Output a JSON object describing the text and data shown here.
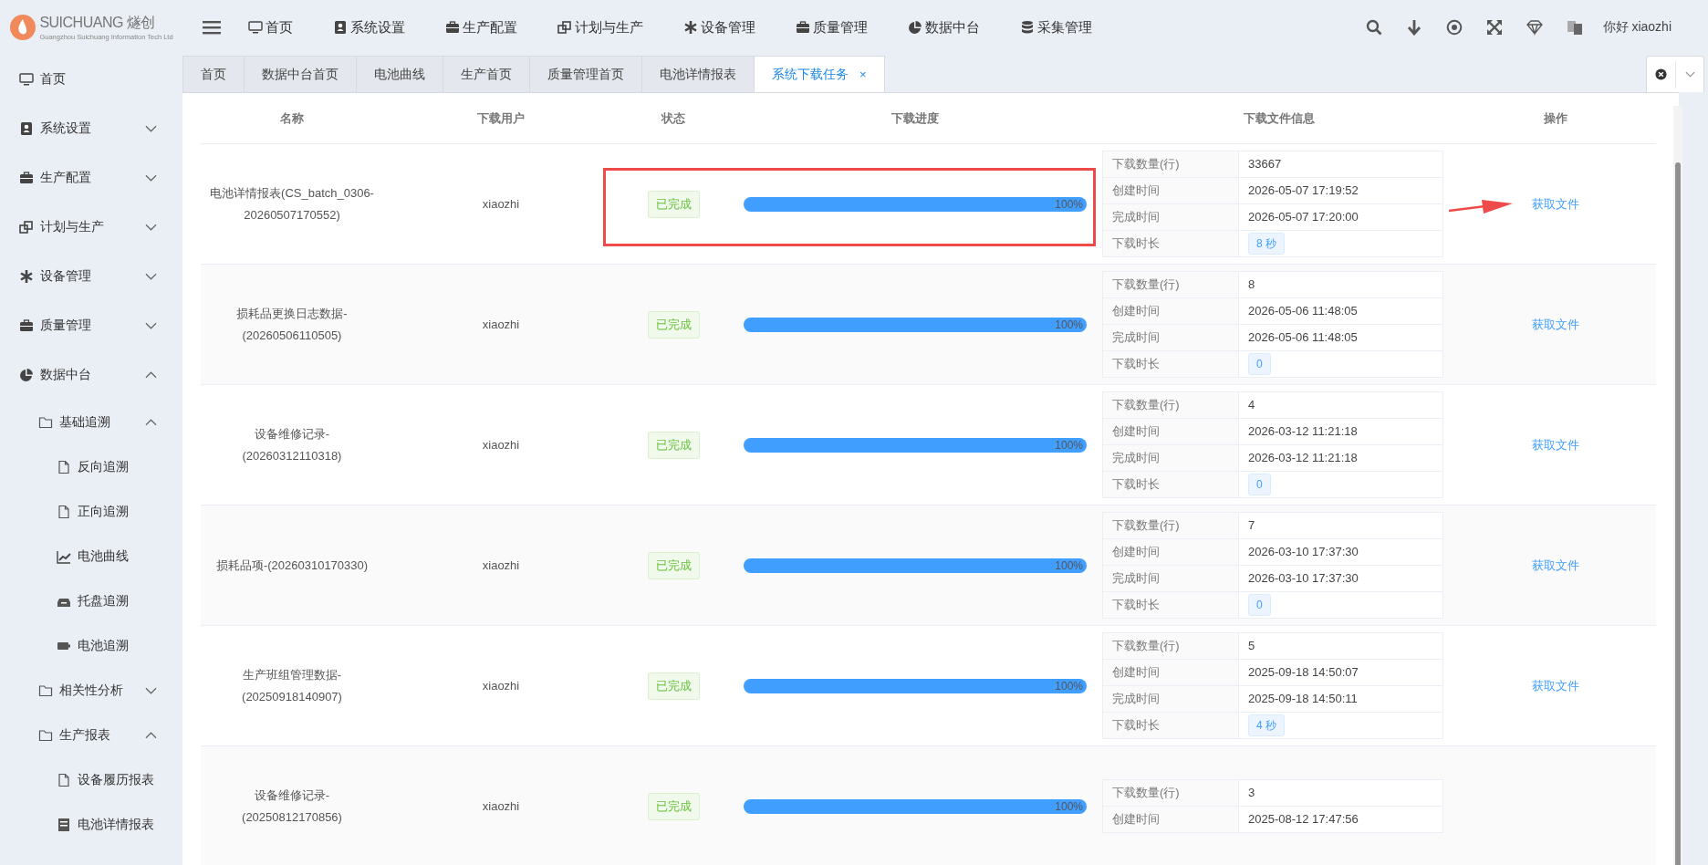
{
  "header": {
    "logo_text": "SUICHUANG 燧创",
    "logo_subtitle": "Guangzhou Suichuang Information Tech Ltd",
    "nav": [
      {
        "label": "首页",
        "kind": "monitor"
      },
      {
        "label": "系统设置",
        "kind": "user-card"
      },
      {
        "label": "生产配置",
        "kind": "briefcase"
      },
      {
        "label": "计划与生产",
        "kind": "windows"
      },
      {
        "label": "设备管理",
        "kind": "asterisk"
      },
      {
        "label": "质量管理",
        "kind": "briefcase"
      },
      {
        "label": "数据中台",
        "kind": "pie"
      },
      {
        "label": "采集管理",
        "kind": "database"
      }
    ],
    "greeting": "你好 xiaozhi"
  },
  "sidebar": {
    "items": [
      {
        "label": "首页",
        "kind": "monitor"
      },
      {
        "label": "系统设置",
        "kind": "user-card",
        "expanded": false
      },
      {
        "label": "生产配置",
        "kind": "briefcase",
        "expanded": false
      },
      {
        "label": "计划与生产",
        "kind": "windows",
        "expanded": false
      },
      {
        "label": "设备管理",
        "kind": "asterisk",
        "expanded": false
      },
      {
        "label": "质量管理",
        "kind": "briefcase",
        "expanded": false
      },
      {
        "label": "数据中台",
        "kind": "pie",
        "expanded": true,
        "children": [
          {
            "label": "基础追溯",
            "kind": "folder",
            "expanded": true,
            "children": [
              {
                "label": "反向追溯",
                "kind": "file"
              },
              {
                "label": "正向追溯",
                "kind": "file"
              },
              {
                "label": "电池曲线",
                "kind": "chart"
              },
              {
                "label": "托盘追溯",
                "kind": "tray"
              },
              {
                "label": "电池追溯",
                "kind": "battery"
              }
            ]
          },
          {
            "label": "相关性分析",
            "kind": "folder",
            "expanded": false
          },
          {
            "label": "生产报表",
            "kind": "folder",
            "expanded": true,
            "children": [
              {
                "label": "设备履历报表",
                "kind": "file"
              },
              {
                "label": "电池详情报表",
                "kind": "report"
              }
            ]
          }
        ]
      }
    ]
  },
  "tabs": [
    {
      "label": "首页",
      "selected": false
    },
    {
      "label": "数据中台首页",
      "selected": false
    },
    {
      "label": "电池曲线",
      "selected": false
    },
    {
      "label": "生产首页",
      "selected": false
    },
    {
      "label": "质量管理首页",
      "selected": false
    },
    {
      "label": "电池详情报表",
      "selected": false
    },
    {
      "label": "系统下载任务",
      "selected": true,
      "close": "×"
    }
  ],
  "table": {
    "columns": [
      "名称",
      "下载用户",
      "状态",
      "下载进度",
      "下载文件信息",
      "操作"
    ],
    "rows": [
      {
        "name": "电池详情报表(CS_batch_0306-20260507170552)",
        "user": "xiaozhi",
        "status": "已完成",
        "level": 1,
        "progress": "100%",
        "action": "获取文件",
        "info": [
          {
            "label": "下载数量(行)",
            "value": "33667",
            "kind": "text"
          },
          {
            "label": "创建时间",
            "value": "2026-05-07 17:19:52",
            "kind": "text"
          },
          {
            "label": "完成时间",
            "value": "2026-05-07 17:20:00",
            "kind": "text"
          },
          {
            "label": "下载时长",
            "value": "8 秒",
            "kind": "tag"
          }
        ]
      },
      {
        "name": "损耗品更换日志数据-(20260506110505)",
        "user": "xiaozhi",
        "status": "已完成",
        "level": 1,
        "progress": "100%",
        "action": "获取文件",
        "info": [
          {
            "label": "下载数量(行)",
            "value": "8",
            "kind": "text"
          },
          {
            "label": "创建时间",
            "value": "2026-05-06 11:48:05",
            "kind": "text"
          },
          {
            "label": "完成时间",
            "value": "2026-05-06 11:48:05",
            "kind": "text"
          },
          {
            "label": "下载时长",
            "value": "0",
            "kind": "tag"
          }
        ]
      },
      {
        "name": "设备维修记录-(20260312110318)",
        "user": "xiaozhi",
        "status": "已完成",
        "level": 1,
        "progress": "100%",
        "action": "获取文件",
        "info": [
          {
            "label": "下载数量(行)",
            "value": "4",
            "kind": "text"
          },
          {
            "label": "创建时间",
            "value": "2026-03-12 11:21:18",
            "kind": "text"
          },
          {
            "label": "完成时间",
            "value": "2026-03-12 11:21:18",
            "kind": "text"
          },
          {
            "label": "下载时长",
            "value": "0",
            "kind": "tag"
          }
        ]
      },
      {
        "name": "损耗品项-(20260310170330)",
        "user": "xiaozhi",
        "status": "已完成",
        "level": 1,
        "progress": "100%",
        "action": "获取文件",
        "info": [
          {
            "label": "下载数量(行)",
            "value": "7",
            "kind": "text"
          },
          {
            "label": "创建时间",
            "value": "2026-03-10 17:37:30",
            "kind": "text"
          },
          {
            "label": "完成时间",
            "value": "2026-03-10 17:37:30",
            "kind": "text"
          },
          {
            "label": "下载时长",
            "value": "0",
            "kind": "tag"
          }
        ]
      },
      {
        "name": "生产班组管理数据-(20250918140907)",
        "user": "xiaozhi",
        "status": "已完成",
        "level": 1,
        "progress": "100%",
        "action": "获取文件",
        "info": [
          {
            "label": "下载数量(行)",
            "value": "5",
            "kind": "text"
          },
          {
            "label": "创建时间",
            "value": "2025-09-18 14:50:07",
            "kind": "text"
          },
          {
            "label": "完成时间",
            "value": "2025-09-18 14:50:11",
            "kind": "text"
          },
          {
            "label": "下载时长",
            "value": "4 秒",
            "kind": "tag"
          }
        ]
      },
      {
        "name": "设备维修记录-(20250812170856)",
        "user": "xiaozhi",
        "status": "已完成",
        "level": 1,
        "progress": "100%",
        "info": [
          {
            "label": "下载数量(行)",
            "value": "3",
            "kind": "text"
          },
          {
            "label": "创建时间",
            "value": "2025-08-12 17:47:56",
            "kind": "text"
          }
        ]
      }
    ]
  }
}
